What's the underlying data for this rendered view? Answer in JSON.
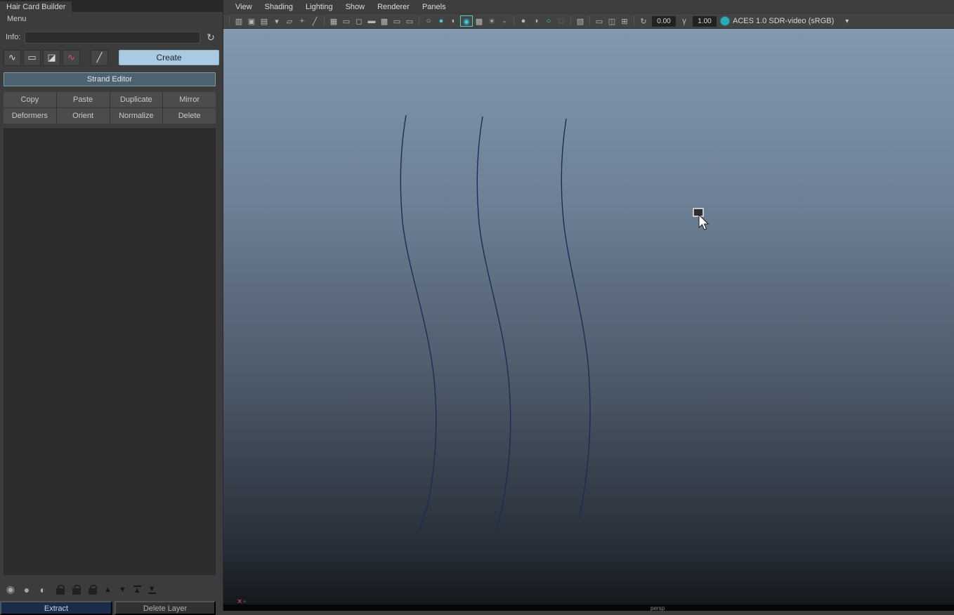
{
  "window": {
    "tab": "Hair Card Builder",
    "menu": "Menu"
  },
  "left_panel": {
    "info_label": "Info:",
    "info_value": "",
    "create_label": "Create",
    "strand_editor_label": "Strand Editor",
    "grid_buttons": [
      [
        "Copy",
        "Paste",
        "Duplicate",
        "Mirror"
      ],
      [
        "Deformers",
        "Orient",
        "Normalize",
        "Delete"
      ]
    ],
    "extract_label": "Extract",
    "delete_layer_label": "Delete Layer"
  },
  "viewport": {
    "menus": [
      "View",
      "Shading",
      "Lighting",
      "Show",
      "Renderer",
      "Panels"
    ],
    "exposure_value": "0.00",
    "gamma_value": "1.00",
    "colorspace_label": "ACES 1.0 SDR-video (sRGB)",
    "camera_label": "persp"
  },
  "icons": {
    "refresh": "↻",
    "curve_tool": "∿",
    "marquee_tool": "▭",
    "sculpt_tool": "◪",
    "warp_tool": "∿",
    "brush_tool": "╱",
    "clock": "◉",
    "sphere": "●",
    "half_sphere": "◐",
    "up": "▲",
    "down": "▼",
    "up_bar": "▲",
    "down_bar": "▼",
    "select_camera": "▥",
    "lock_camera": "▣",
    "camera_attrs": "▤",
    "bookmark": "▾",
    "image_plane": "▱",
    "pan_zoom": "+",
    "grease_pencil": "╱",
    "grid": "▦",
    "film_gate": "▭",
    "resolution_gate": "◻",
    "gate_mask": "▬",
    "field_chart": "▩",
    "safe_action": "▭",
    "safe_title": "▭",
    "wireframe": "○",
    "shaded": "●",
    "textured": "◐",
    "textured_shaded": "◉",
    "default_material": "▩",
    "lights": "☀",
    "shadows": "◒",
    "ao": "●",
    "antialias": "◑",
    "motion_blur": "○",
    "dof": "□",
    "isolate_select": "▧",
    "pane_single": "▭",
    "pane_two": "◫",
    "pane_four": "⊞",
    "exposure": "↻",
    "gamma": "γ",
    "dropdown": "▾",
    "axis_x": "×",
    "axis_origin": "+",
    "lock": "css-lock-shape",
    "view_transform_on": "css-teal-circle"
  },
  "colors": {
    "accent_teal": "#4cc9ce",
    "create_blue": "#abc9e0",
    "strand_editor_blue": "#4e6270",
    "extract_navy": "#1b2b4a",
    "viewport_gradient_top": "#8298ae",
    "viewport_gradient_bottom": "#121519",
    "curve": "#1d2c56"
  }
}
